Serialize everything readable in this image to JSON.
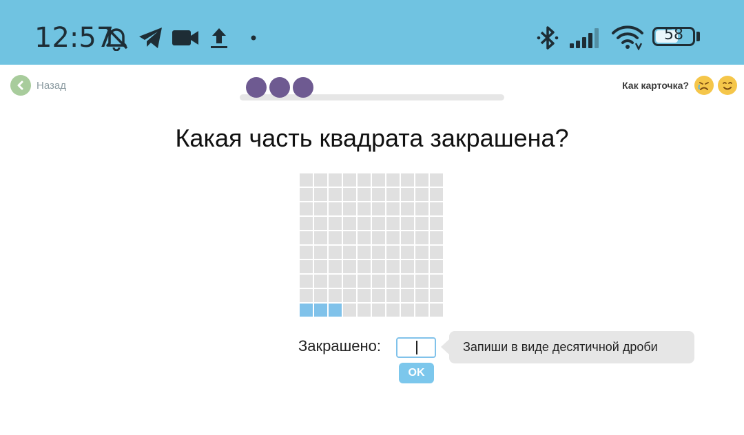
{
  "status_bar": {
    "time": "12:57",
    "battery": "58",
    "battery_level_fraction": 0.58,
    "icons": [
      "bell-off-icon",
      "telegram-icon",
      "video-camera-icon",
      "upload-icon",
      "dot-icon",
      "bluetooth-icon",
      "signal-icon",
      "wifi-icon",
      "battery-icon"
    ]
  },
  "nav": {
    "back_label": "Назад"
  },
  "progress": {
    "dots_completed": 3,
    "dot_color": "#6e5a91"
  },
  "rating": {
    "label": "Как карточка?",
    "icons": [
      "sad-face-icon",
      "smile-face-icon"
    ]
  },
  "question": "Какая часть квадрата закрашена?",
  "grid": {
    "rows": 10,
    "cols": 10,
    "filled_cells": 3,
    "empty_color": "#e0e0e0",
    "fill_color": "#80c2ea"
  },
  "answer": {
    "label": "Закрашено:",
    "value": "",
    "ok_label": "OK"
  },
  "hint": "Запиши в виде десятичной дроби",
  "colors": {
    "status_bar": "#70c3e1",
    "back_button": "#a8cc9c",
    "accent": "#7cc7ec",
    "face": "#f5c64a"
  }
}
